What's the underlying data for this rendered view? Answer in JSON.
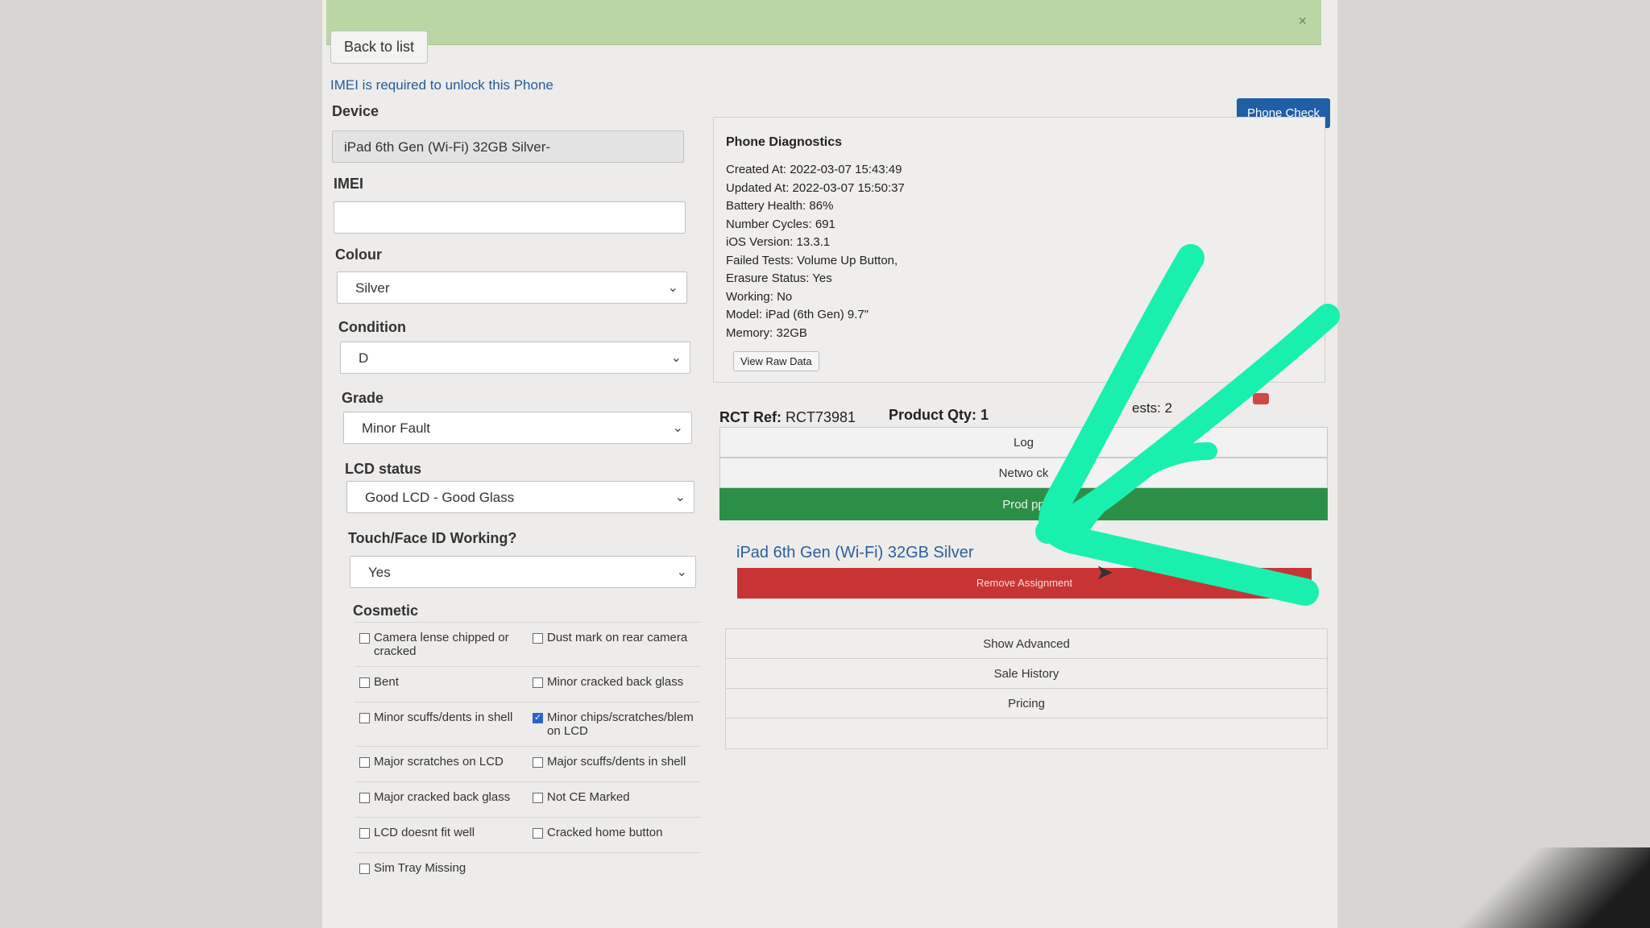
{
  "alert": {
    "close_label": "×"
  },
  "back_button": "Back to list",
  "imei_note": "IMEI is required to unlock this Phone",
  "fields": {
    "device": {
      "label": "Device",
      "value": "iPad 6th Gen (Wi-Fi) 32GB Silver-"
    },
    "imei": {
      "label": "IMEI",
      "value": ""
    },
    "colour": {
      "label": "Colour",
      "value": "Silver"
    },
    "condition": {
      "label": "Condition",
      "value": "D"
    },
    "grade": {
      "label": "Grade",
      "value": "Minor Fault"
    },
    "lcd_status": {
      "label": "LCD status",
      "value": "Good LCD - Good Glass"
    },
    "touch_face_id": {
      "label": "Touch/Face ID Working?",
      "value": "Yes"
    }
  },
  "cosmetic": {
    "title": "Cosmetic",
    "rows": [
      [
        {
          "label": "Camera lense chipped or cracked",
          "checked": false
        },
        {
          "label": "Dust mark on rear camera",
          "checked": false
        }
      ],
      [
        {
          "label": "Bent",
          "checked": false
        },
        {
          "label": "Minor cracked back glass",
          "checked": false
        }
      ],
      [
        {
          "label": "Minor scuffs/dents in shell",
          "checked": false
        },
        {
          "label": "Minor chips/scratches/blem on LCD",
          "checked": true
        }
      ],
      [
        {
          "label": "Major scratches on LCD",
          "checked": false
        },
        {
          "label": "Major scuffs/dents in shell",
          "checked": false
        }
      ],
      [
        {
          "label": "Major cracked back glass",
          "checked": false
        },
        {
          "label": "Not CE Marked",
          "checked": false
        }
      ],
      [
        {
          "label": "LCD doesnt fit well",
          "checked": false
        },
        {
          "label": "Cracked home button",
          "checked": false
        }
      ],
      [
        {
          "label": "Sim Tray Missing",
          "checked": false
        },
        null
      ]
    ]
  },
  "phone_check_button": "Phone Check",
  "diagnostics": {
    "title": "Phone Diagnostics",
    "lines": [
      "Created At: 2022-03-07 15:43:49",
      "Updated At: 2022-03-07 15:50:37",
      "Battery Health: 86%",
      "Number Cycles: 691",
      "iOS Version: 13.3.1",
      "Failed Tests: Volume Up Button,",
      "Erasure Status: Yes",
      "Working: No",
      "Model: iPad (6th Gen) 9.7\"",
      "Memory: 32GB"
    ],
    "raw_button": "View Raw Data"
  },
  "rct": {
    "label": "RCT Ref:",
    "value": "RCT73981",
    "qty": "Product Qty: 1",
    "tests": "ests: 2"
  },
  "accordion": {
    "log": "Log",
    "network": "Netwo    ck",
    "product": "Prod    pp"
  },
  "device_link": "iPad 6th Gen (Wi-Fi) 32GB Silver",
  "remove_button": "Remove Assignment",
  "advanced": {
    "show_advanced": "Show Advanced",
    "sale_history": "Sale History",
    "pricing": "Pricing"
  },
  "colors": {
    "primary_blue": "#1f5fa6",
    "success_green": "#2c8f47",
    "danger_red": "#c83434",
    "alert_green": "#b9d6a4",
    "annotation_arrow": "#19f0b0"
  },
  "annotation": {
    "icon": "arrow-annotation-icon"
  }
}
